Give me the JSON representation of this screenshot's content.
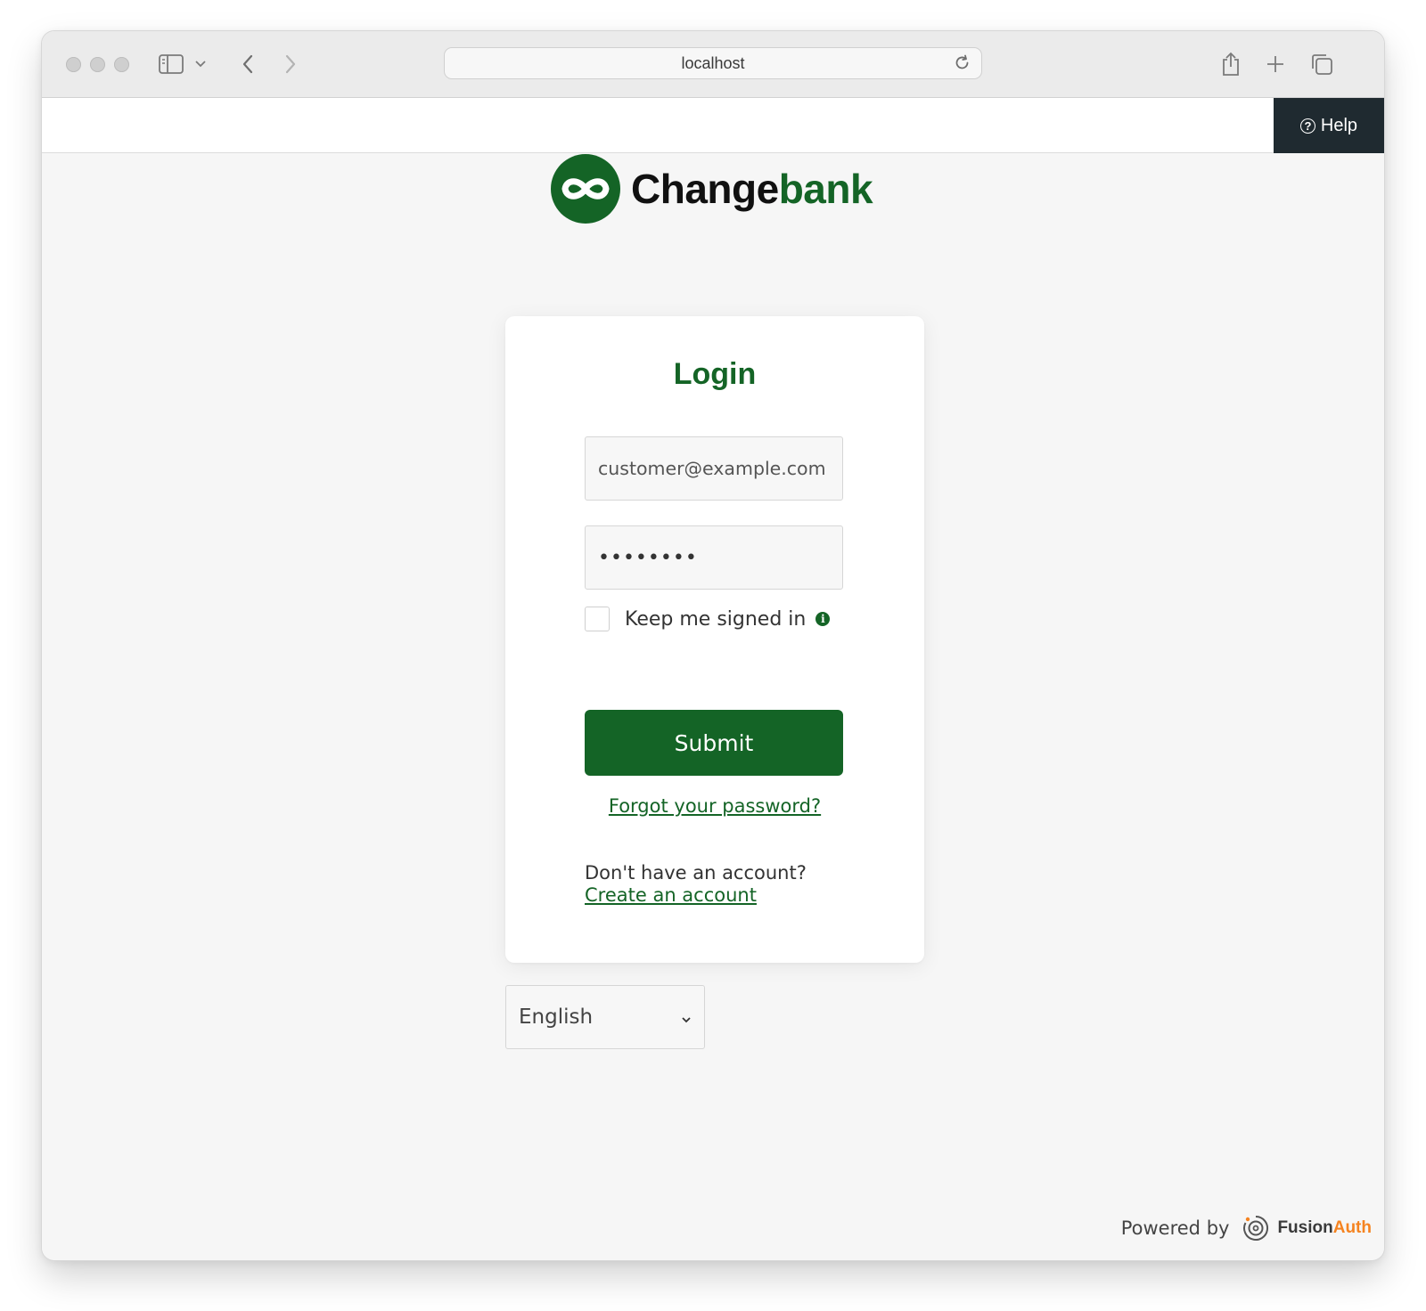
{
  "browser": {
    "url": "localhost",
    "controls": {
      "sidebar_icon": "sidebar-icon",
      "back_icon": "chevron-left-icon",
      "forward_icon": "chevron-right-icon",
      "reload_icon": "reload-icon",
      "share_icon": "share-icon",
      "new_tab_icon": "plus-icon",
      "tabs_icon": "tabs-overview-icon"
    }
  },
  "header": {
    "help_label": "Help"
  },
  "brand": {
    "name_part1": "Change",
    "name_part2": "bank",
    "color": "#146426"
  },
  "login": {
    "title": "Login",
    "email_value": "customer@example.com",
    "password_masked": "••••••••",
    "remember_label": "Keep me signed in",
    "remember_checked": false,
    "submit_label": "Submit",
    "forgot_label": "Forgot your password?",
    "no_account_text": "Don't have an account?",
    "create_account_label": "Create an account"
  },
  "language": {
    "selected": "English"
  },
  "footer": {
    "powered_by": "Powered by",
    "vendor_part1": "Fusion",
    "vendor_part2": "Auth",
    "vendor_accent": "#f58320"
  }
}
